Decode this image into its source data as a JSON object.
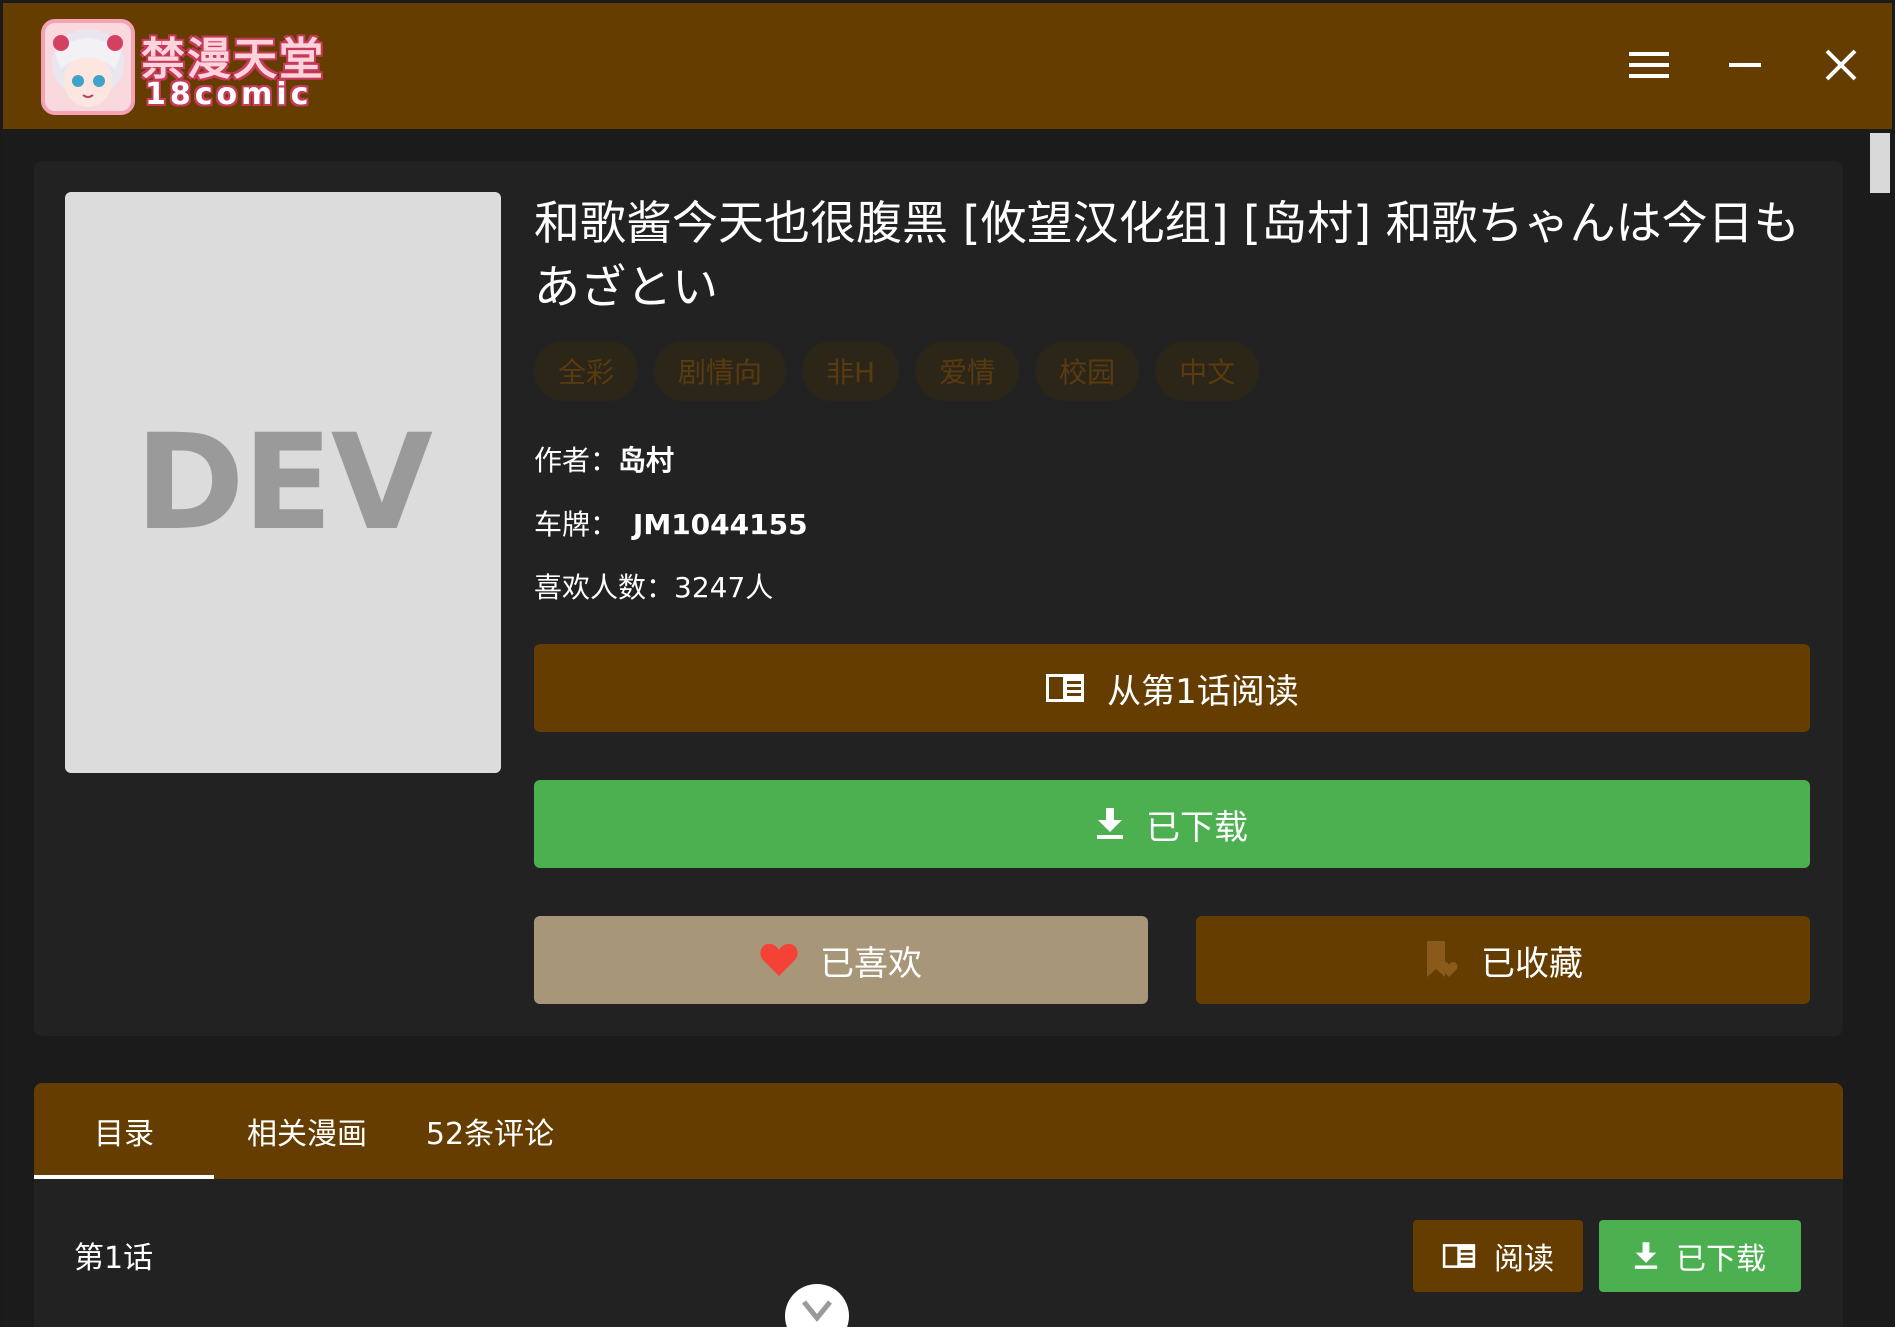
{
  "app": {
    "logo_title": "禁漫天堂",
    "logo_sub": "18comic"
  },
  "window_controls": {
    "menu_icon": "menu-icon",
    "minimize_icon": "minimize-icon",
    "close_icon": "close-icon"
  },
  "comic": {
    "cover_placeholder": "DEV",
    "title": "和歌酱今天也很腹黑 [攸望汉化组] [岛村] 和歌ちゃんは今日もあざとい",
    "tags": [
      "全彩",
      "剧情向",
      "非H",
      "爱情",
      "校园",
      "中文"
    ],
    "author_label": "作者：",
    "author": "岛村",
    "id_label": "车牌：",
    "id": "JM1044155",
    "likes_label": "喜欢人数：",
    "likes": "3247人"
  },
  "actions": {
    "read_from_first": "从第1话阅读",
    "downloaded": "已下载",
    "liked": "已喜欢",
    "favorited": "已收藏"
  },
  "tabs": [
    {
      "label": "目录",
      "active": true
    },
    {
      "label": "相关漫画",
      "active": false
    },
    {
      "label": "52条评论",
      "active": false
    }
  ],
  "chapters": [
    {
      "name": "第1话",
      "read_label": "阅读",
      "download_label": "已下载"
    }
  ],
  "colors": {
    "brand_brown": "#663d00",
    "green": "#4caf50",
    "tan": "#a89679",
    "heart_red": "#f44336"
  }
}
